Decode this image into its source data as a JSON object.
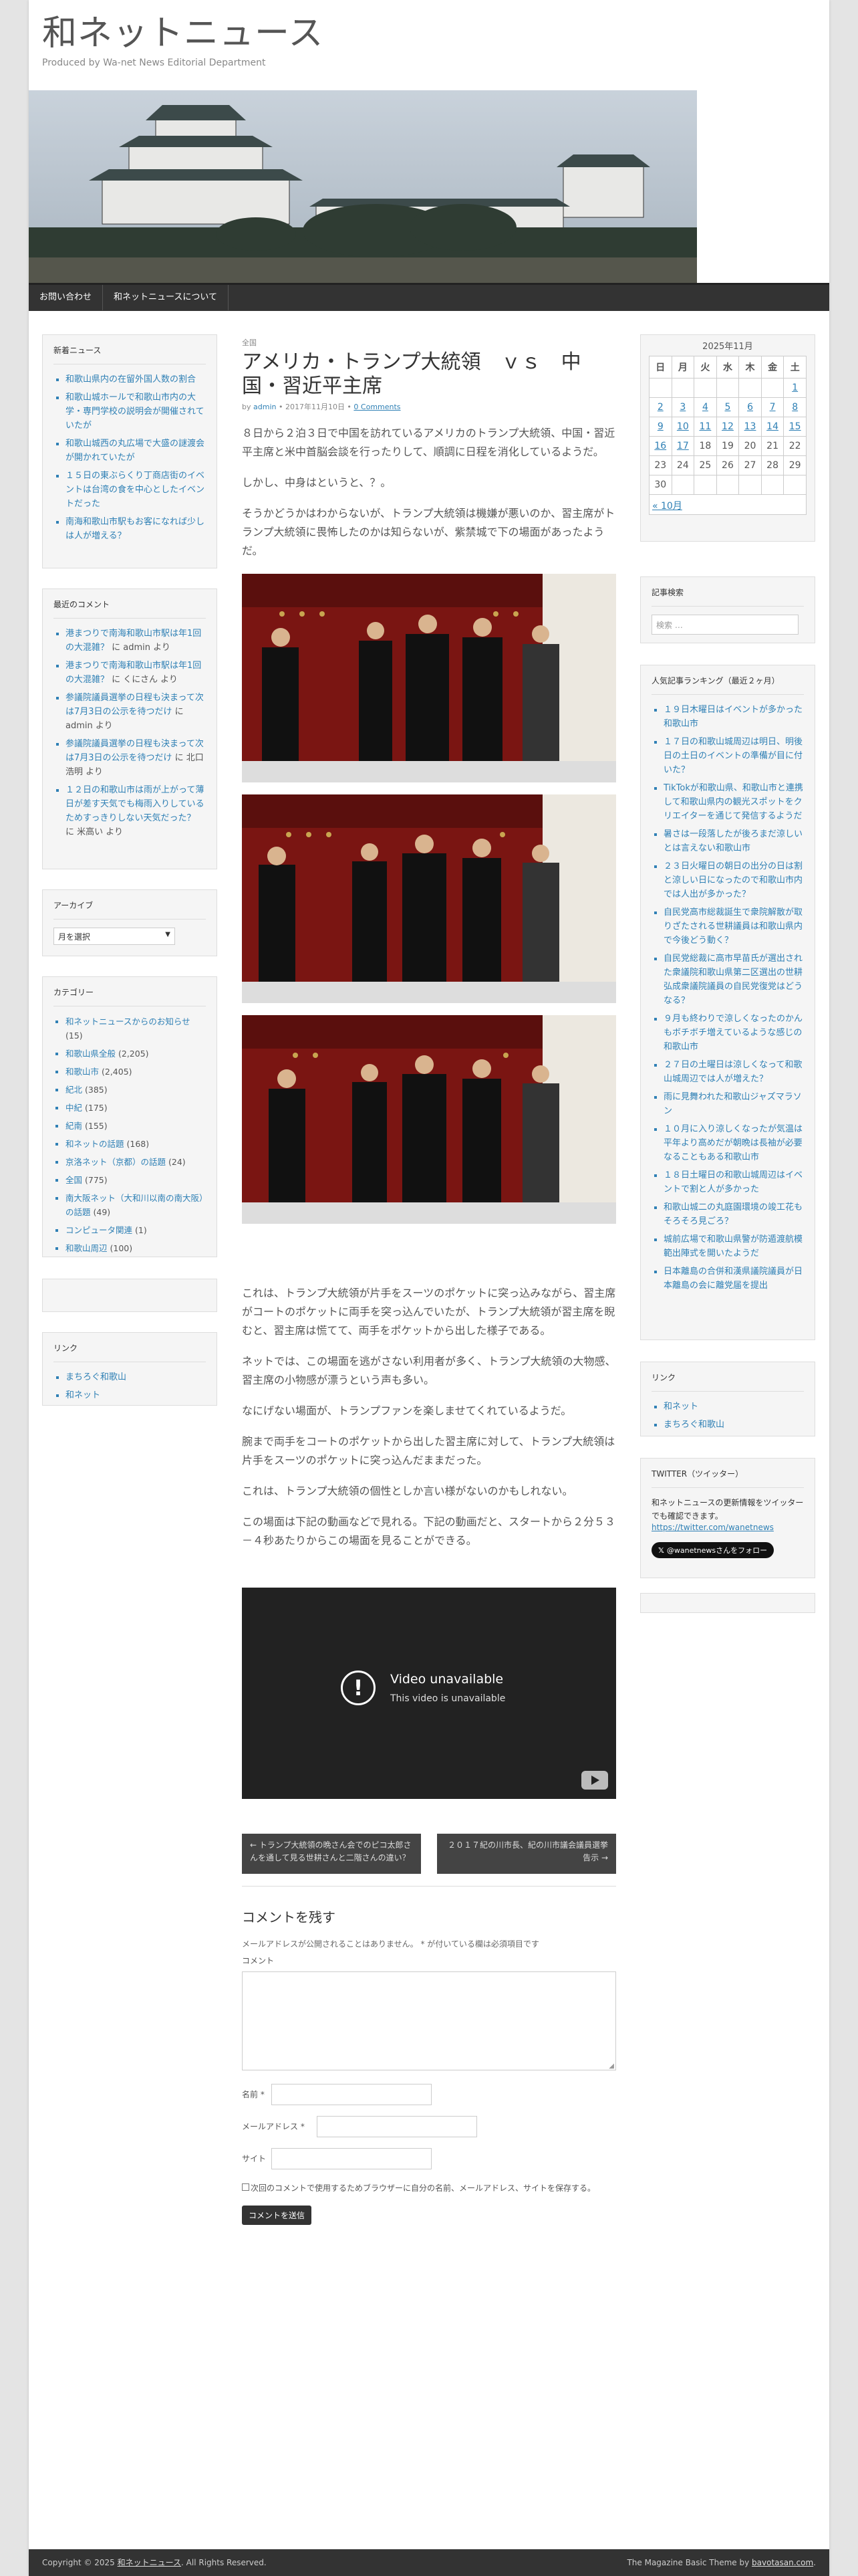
{
  "site": {
    "title": "和ネットニュース",
    "description": "Produced by Wa-net News Editorial Department"
  },
  "nav": {
    "items": [
      "お問い合わせ",
      "和ネットニュースについて"
    ]
  },
  "left": {
    "news": {
      "title": "新着ニュース",
      "items": [
        "和歌山県内の在留外国人数の割合",
        "和歌山城ホールで和歌山市内の大学・専門学校の説明会が開催されていたが",
        "和歌山城西の丸広場で大盛の謎渡会が開かれていたが",
        "１５日の東ぶらくり丁商店街のイベントは台湾の食を中心としたイベントだった",
        "南海和歌山市駅もお客になれば少しは人が増える？"
      ]
    },
    "comments": {
      "title": "最近のコメント",
      "items": [
        {
          "link": "港まつりで南海和歌山市駅は年1回の大混雑？",
          "rest": " に admin より"
        },
        {
          "link": "港まつりで南海和歌山市駅は年1回の大混雑？",
          "rest": " に くにさん より"
        },
        {
          "link": "参議院議員選挙の日程も決まって次は7月3日の公示を待つだけ",
          "rest": " に admin より"
        },
        {
          "link": "参議院議員選挙の日程も決まって次は7月3日の公示を待つだけ",
          "rest": " に 北口浩明 より"
        },
        {
          "link": "１２日の和歌山市は雨が上がって薄日が差す天気でも梅雨入りしているためすっきりしない天気だった？",
          "rest": " に 米高い より"
        }
      ]
    },
    "archive": {
      "title": "アーカイブ",
      "select": "月を選択"
    },
    "categories": {
      "title": "カテゴリー",
      "items": [
        {
          "name": "和ネットニュースからのお知らせ",
          "count": " (15)"
        },
        {
          "name": "和歌山県全般",
          "count": " (2,205)"
        },
        {
          "name": "和歌山市",
          "count": " (2,405)"
        },
        {
          "name": "紀北",
          "count": " (385)"
        },
        {
          "name": "中紀",
          "count": " (175)"
        },
        {
          "name": "紀南",
          "count": " (155)"
        },
        {
          "name": "和ネットの話題",
          "count": " (168)"
        },
        {
          "name": "京洛ネット（京都）の話題",
          "count": " (24)"
        },
        {
          "name": "全国",
          "count": " (775)"
        },
        {
          "name": "南大阪ネット（大和川以南の南大阪）の話題",
          "count": " (49)"
        },
        {
          "name": "コンピュータ関連",
          "count": " (1)"
        },
        {
          "name": "和歌山周辺",
          "count": " (100)"
        }
      ]
    },
    "links": {
      "title": "リンク",
      "items": [
        "まちろぐ和歌山",
        "和ネット"
      ]
    }
  },
  "article": {
    "category": "全国",
    "title": "アメリカ・トランプ大統領　ｖｓ　中国・習近平主席",
    "meta_by": "by ",
    "author": "admin",
    "date": " • 2017年11月10日 • ",
    "comments": "0 Comments",
    "p1": "８日から２泊３日で中国を訪れているアメリカのトランプ大統領、中国・習近平主席と米中首脳会談を行ったりして、順調に日程を消化しているようだ。",
    "p2": "しかし、中身はというと、？。",
    "p3": "そうかどうかはわからないが、トランプ大統領は機嫌が悪いのか、習主席がトランプ大統領に畏怖したのかは知らないが、紫禁城で下の場面があったようだ。",
    "p4": "これは、トランプ大統領が片手をスーツのポケットに突っ込みながら、習主席がコートのポケットに両手を突っ込んでいたが、トランプ大統領が習主席を睨むと、習主席は慌てて、両手をポケットから出した様子である。",
    "p5": "ネットでは、この場面を逃がさない利用者が多く、トランプ大統領の大物感、習主席の小物感が漂うという声も多い。",
    "p6": "なにげない場面が、トランプファンを楽しませてくれているようだ。",
    "p7": "腕まで両手をコートのポケットから出した習主席に対して、トランプ大統領は片手をスーツのポケットに突っ込んだままだった。",
    "p8": "これは、トランプ大統領の個性としか言い様がないのかもしれない。",
    "p9": "この場面は下記の動画などで見れる。下記の動画だと、スタートから２分５３－４秒あたりからこの場面を見ることができる。",
    "video_title": "Video unavailable",
    "video_sub": "This video is unavailable",
    "prev": "← トランプ大統領の晩さん会でのピコ太郎さんを通して見る世耕さんと二階さんの違い？",
    "next": "２０１７紀の川市長、紀の川市議会議員選挙告示 →"
  },
  "respond": {
    "title": "コメントを残す",
    "note": "メールアドレスが公開されることはありません。 * が付いている欄は必須項目です",
    "comment_label": "コメント",
    "name_label": "名前 *",
    "email_label": "メールアドレス *",
    "site_label": "サイト",
    "cookie_label": "次回のコメントで使用するためブラウザーに自分の名前、メールアドレス、サイトを保存する。",
    "submit": "コメントを送信"
  },
  "right": {
    "calendar": {
      "caption": "2025年11月",
      "days": [
        "日",
        "月",
        "火",
        "水",
        "木",
        "金",
        "土"
      ],
      "rows": [
        [
          "",
          "",
          "",
          "",
          "",
          "",
          "1"
        ],
        [
          "2",
          "3",
          "4",
          "5",
          "6",
          "7",
          "8"
        ],
        [
          "9",
          "10",
          "11",
          "12",
          "13",
          "14",
          "15"
        ],
        [
          "16",
          "17",
          "18",
          "19",
          "20",
          "21",
          "22"
        ],
        [
          "23",
          "24",
          "25",
          "26",
          "27",
          "28",
          "29"
        ],
        [
          "30",
          "",
          "",
          "",
          "",
          "",
          ""
        ]
      ],
      "linked": [
        "1",
        "2",
        "3",
        "4",
        "5",
        "6",
        "7",
        "8",
        "9",
        "10",
        "11",
        "12",
        "13",
        "14",
        "15",
        "16",
        "17"
      ],
      "prev": "« 10月"
    },
    "search": {
      "title": "記事検索",
      "placeholder": "検索 …"
    },
    "ranking": {
      "title": "人気記事ランキング（最近２ヶ月）",
      "items": [
        "１９日木曜日はイベントが多かった和歌山市",
        "１７日の和歌山城周辺は明日、明後日の土日のイベントの準備が目に付いた？",
        "TikTokが和歌山県、和歌山市と連携して和歌山県内の観光スポットをクリエイターを通じて発信するようだ",
        "暑さは一段落したが後ろまだ涼しいとは言えない和歌山市",
        "２３日火曜日の朝日の出分の日は割と涼しい日になったので和歌山市内では人出が多かった？",
        "自民党高市総裁誕生で衆院解散が取りざたされる世耕議員は和歌山県内で今後どう動く？",
        "自民党総裁に高市早苗氏が選出された衆議院和歌山県第二区選出の世耕弘成衆議院議員の自民党復党はどうなる？",
        "９月も終わりで涼しくなったのかんもボチボチ増えているような感じの和歌山市",
        "２７日の土曜日は涼しくなって和歌山城周辺では人が増えた？",
        "雨に見舞われた和歌山ジャズマラソン",
        "１０月に入り涼しくなったが気温は平年より高めだが朝晩は長袖が必要なることもある和歌山市",
        "１８日土曜日の和歌山城周辺はイベントで割と人が多かった",
        "和歌山城二の丸庭園環境の竣工花もそろそろ見ごろ？",
        "城前広場で和歌山県警が防遁渡航模範出陣式を開いたようだ",
        "日本離島の合併和漢県議院議員が日本離島の会に離党届を提出"
      ]
    },
    "links": {
      "title": "リンク",
      "items": [
        "和ネット",
        "まちろぐ和歌山"
      ]
    },
    "twitter": {
      "title": "TWITTER（ツイッター）",
      "text": "和ネットニュースの更新情報をツイッターでも確認できます。",
      "url": "https://twitter.com/wanetnews",
      "follow": "@wanetnewsさんをフォロー"
    }
  },
  "footer": {
    "copyright": "Copyright © 2025 ",
    "site_link": "和ネットニュース",
    "rights": ". All Rights Reserved.",
    "theme": "The Magazine Basic Theme by ",
    "theme_link": "bavotasan.com",
    "end": "."
  }
}
